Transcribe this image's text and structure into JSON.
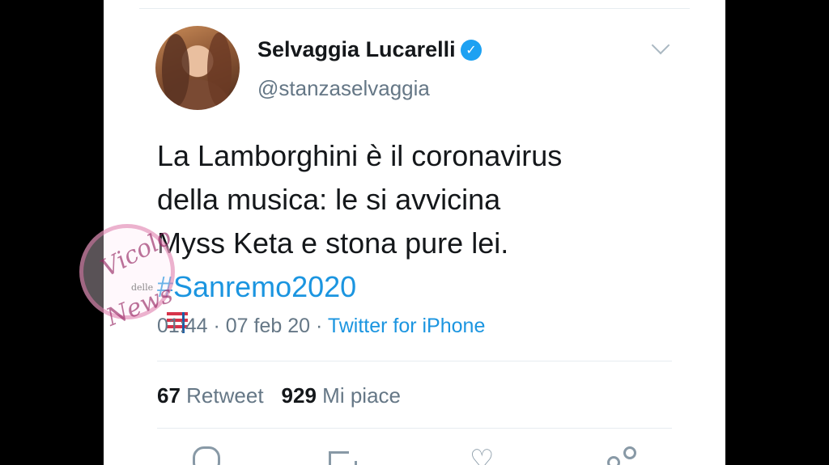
{
  "tweet": {
    "author_name": "Selvaggia Lucarelli",
    "handle": "@stanzaselvaggia",
    "text_lines": [
      "La Lamborghini è il coronavirus",
      "della musica: le si avvicina",
      "Myss Keta e stona pure lei."
    ],
    "hashtag": "#Sanremo2020",
    "time": "01:44",
    "date": "07 feb 20",
    "source": "Twitter for iPhone",
    "retweets_count": "67",
    "retweets_label": "Retweet",
    "likes_count": "929",
    "likes_label": "Mi piace"
  },
  "icons": {
    "verified": "verified-badge-icon",
    "chevron": "chevron-down-icon",
    "music": "music-notes-icon",
    "reply": "reply-icon",
    "retweet": "retweet-icon",
    "like": "heart-icon",
    "share": "share-icon"
  },
  "colors": {
    "link": "#1b95e0",
    "verified": "#1da1f2",
    "text": "#14171a",
    "secondary": "#657786"
  },
  "watermark": {
    "line1": "Vicolo",
    "line2": "delle",
    "line3": "News"
  }
}
